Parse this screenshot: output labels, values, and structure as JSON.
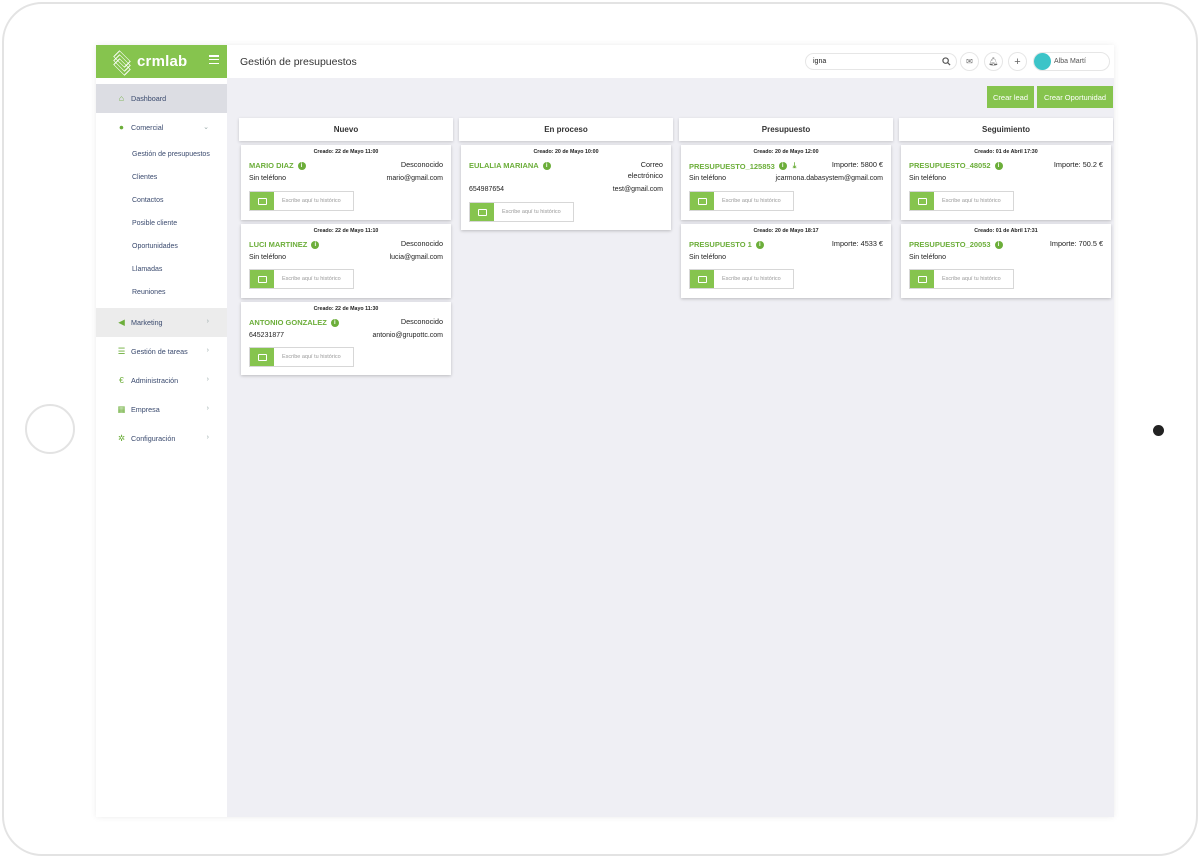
{
  "app": {
    "brand": "crmlab",
    "page_title": "Gestión de presupuestos"
  },
  "header": {
    "search_value": "igna",
    "user_name": "Alba Martí"
  },
  "sidebar": {
    "items": [
      {
        "label": "Dashboard",
        "icon": "home-icon"
      },
      {
        "label": "Comercial",
        "icon": "user-icon"
      },
      {
        "label": "Marketing",
        "icon": "megaphone-icon"
      },
      {
        "label": "Gestión de tareas",
        "icon": "list-icon"
      },
      {
        "label": "Administración",
        "icon": "euro-icon"
      },
      {
        "label": "Empresa",
        "icon": "building-icon"
      },
      {
        "label": "Configuración",
        "icon": "gear-icon"
      }
    ],
    "sub_items": [
      "Gestión de presupuestos",
      "Clientes",
      "Contactos",
      "Posible cliente",
      "Oportunidades",
      "Llamadas",
      "Reuniones"
    ]
  },
  "actions": {
    "create_lead": "Crear lead",
    "create_opportunity": "Crear Oportunidad"
  },
  "history_placeholder": "Escribe aquí tu histórico",
  "columns": [
    {
      "title": "Nuevo",
      "cards": [
        {
          "created": "Creado: 22 de Mayo 11:00",
          "name": "MARIO DIAZ",
          "right1": "Desconocido",
          "left2": "Sin teléfono",
          "right2": "mario@gmail.com"
        },
        {
          "created": "Creado: 22 de Mayo 11:10",
          "name": "LUCI MARTINEZ",
          "right1": "Desconocido",
          "left2": "Sin teléfono",
          "right2": "lucia@gmail.com"
        },
        {
          "created": "Creado: 22 de Mayo 11:30",
          "name": "ANTONIO GONZALEZ",
          "right1": "Desconocido",
          "left2": "645231877",
          "right2": "antonio@grupottc.com"
        }
      ]
    },
    {
      "title": "En proceso",
      "cards": [
        {
          "created": "Creado: 20 de Mayo 10:00",
          "name": "EULALIA MARIANA",
          "right1a": "Correo",
          "right1b": "electrónico",
          "left2": "654987654",
          "right2": "test@gmail.com"
        }
      ]
    },
    {
      "title": "Presupuesto",
      "cards": [
        {
          "created": "Creado: 20 de Mayo 12:00",
          "name": "PRESUPUESTO_125853",
          "right1": "Importe: 5800 €",
          "left2": "Sin teléfono",
          "right2": "jcarmona.dabasystem@gmail.com"
        },
        {
          "created": "Creado: 20 de Mayo 18:17",
          "name": "PRESUPUESTO 1",
          "right1": "Importe: 4533 €",
          "left2": "Sin teléfono"
        }
      ]
    },
    {
      "title": "Seguimiento",
      "cards": [
        {
          "created": "Creado: 01 de Abril 17:30",
          "name": "PRESUPUESTO_48052",
          "right1": "Importe: 50.2 €",
          "left2": "Sin teléfono"
        },
        {
          "created": "Creado: 01 de Abril 17:31",
          "name": "PRESUPUESTO_20053",
          "right1": "Importe: 700.5 €",
          "left2": "Sin teléfono"
        }
      ]
    }
  ],
  "colors": {
    "accent": "#86c44e",
    "name_green": "#6cae3a",
    "nav_text": "#3a4a6e",
    "background": "#efeff4"
  }
}
